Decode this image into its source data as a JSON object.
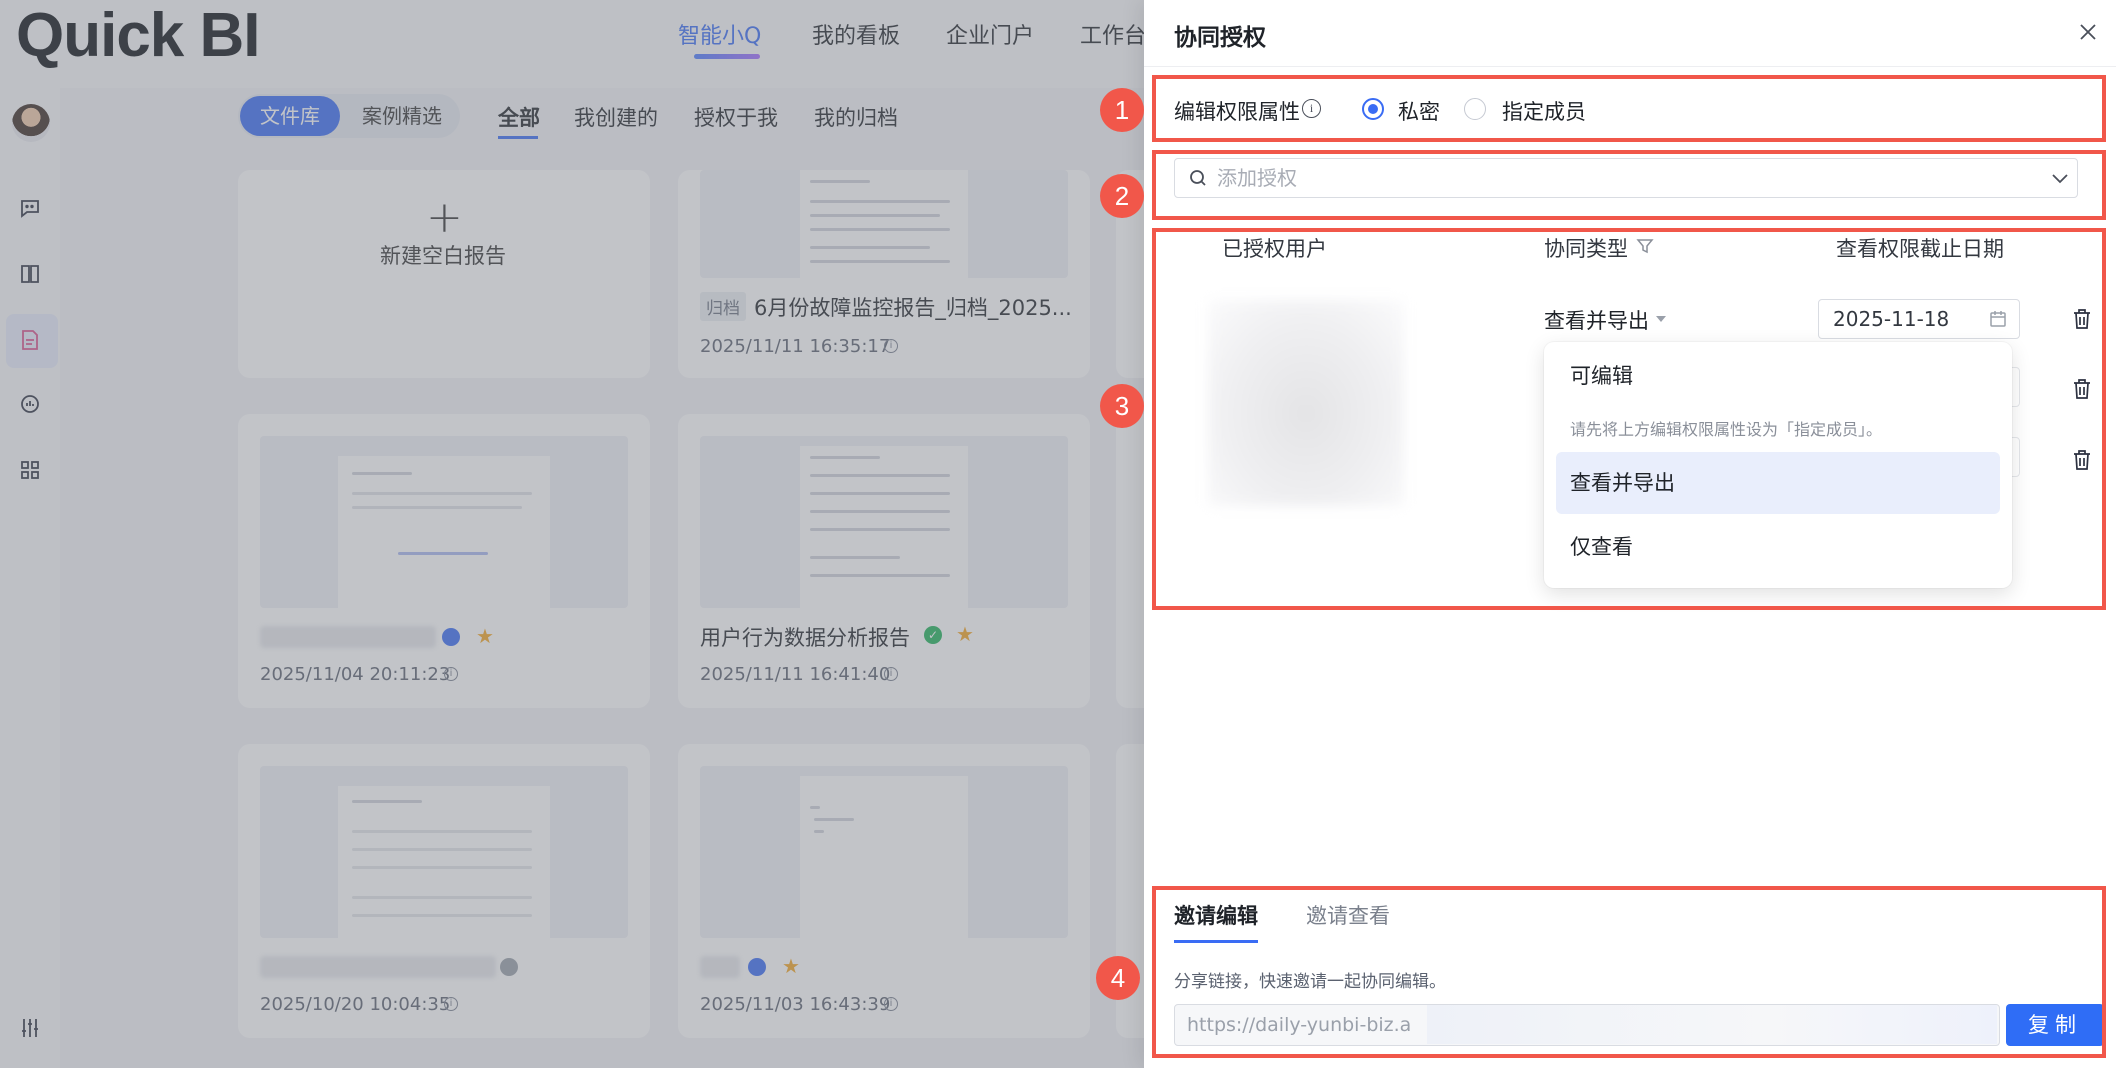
{
  "app": {
    "logo": "Quick BI",
    "top_nav": [
      "智能小Q",
      "我的看板",
      "企业门户",
      "工作台"
    ],
    "library_tabs": [
      "文件库",
      "案例精选"
    ],
    "filter_tabs": [
      "全部",
      "我创建的",
      "授权于我",
      "我的归档"
    ],
    "new_report_label": "新建空白报告",
    "cards": [
      {
        "tag": "归档",
        "title": "6月份故障监控报告_归档_2025...",
        "date": "2025/11/11 16:35:17"
      },
      {
        "title": "",
        "date": "2025/11/04 20:11:23"
      },
      {
        "title": "用户行为数据分析报告",
        "date": "2025/11/11 16:41:40"
      },
      {
        "title": "",
        "date": "2025/10/20 10:04:35"
      },
      {
        "title": "",
        "date": "2025/11/03 16:43:39"
      }
    ]
  },
  "drawer": {
    "title": "协同授权",
    "markers": [
      "1",
      "2",
      "3",
      "4"
    ],
    "permission": {
      "label": "编辑权限属性",
      "info_icon_glyph": "i",
      "options": [
        "私密",
        "指定成员"
      ],
      "selected": "私密"
    },
    "search": {
      "placeholder": "添加授权"
    },
    "table": {
      "headers": [
        "已授权用户",
        "协同类型",
        "查看权限截止日期"
      ],
      "row": {
        "collab_type": "查看并导出",
        "expiry_date": "2025-11-18"
      }
    },
    "dropdown": {
      "items": [
        "可编辑",
        "查看并导出",
        "仅查看"
      ],
      "hint": "请先将上方编辑权限属性设为「指定成员」。",
      "selected": "查看并导出"
    },
    "invite": {
      "tabs": [
        "邀请编辑",
        "邀请查看"
      ],
      "active_tab": "邀请编辑",
      "hint": "分享链接，快速邀请一起协同编辑。",
      "link": "https://daily-yunbi-biz.a",
      "copy_label": "复制"
    }
  },
  "colors": {
    "accent": "#3a6cf4",
    "annotation": "#f1574a",
    "star": "#f5a623"
  }
}
